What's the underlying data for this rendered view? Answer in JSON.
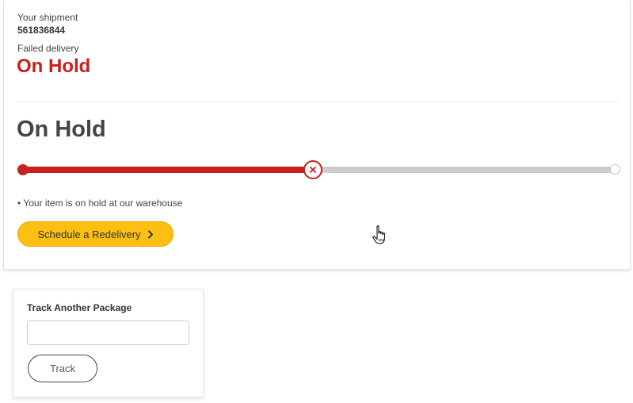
{
  "shipment": {
    "label": "Your shipment",
    "number": "561836844",
    "status_label": "Failed delivery",
    "status": "On Hold"
  },
  "status_section": {
    "heading": "On Hold",
    "progress_fraction": 0.49,
    "note": "• Your item is on hold at our warehouse",
    "redelivery_button": "Schedule a Redelivery",
    "button_icon": "chevron-right-icon"
  },
  "track_another": {
    "title": "Track Another Package",
    "input_value": "",
    "input_placeholder": "",
    "button": "Track"
  },
  "colors": {
    "accent_red": "#c8201c",
    "button_yellow": "#fcbf12",
    "track_grey": "#cccccc"
  }
}
